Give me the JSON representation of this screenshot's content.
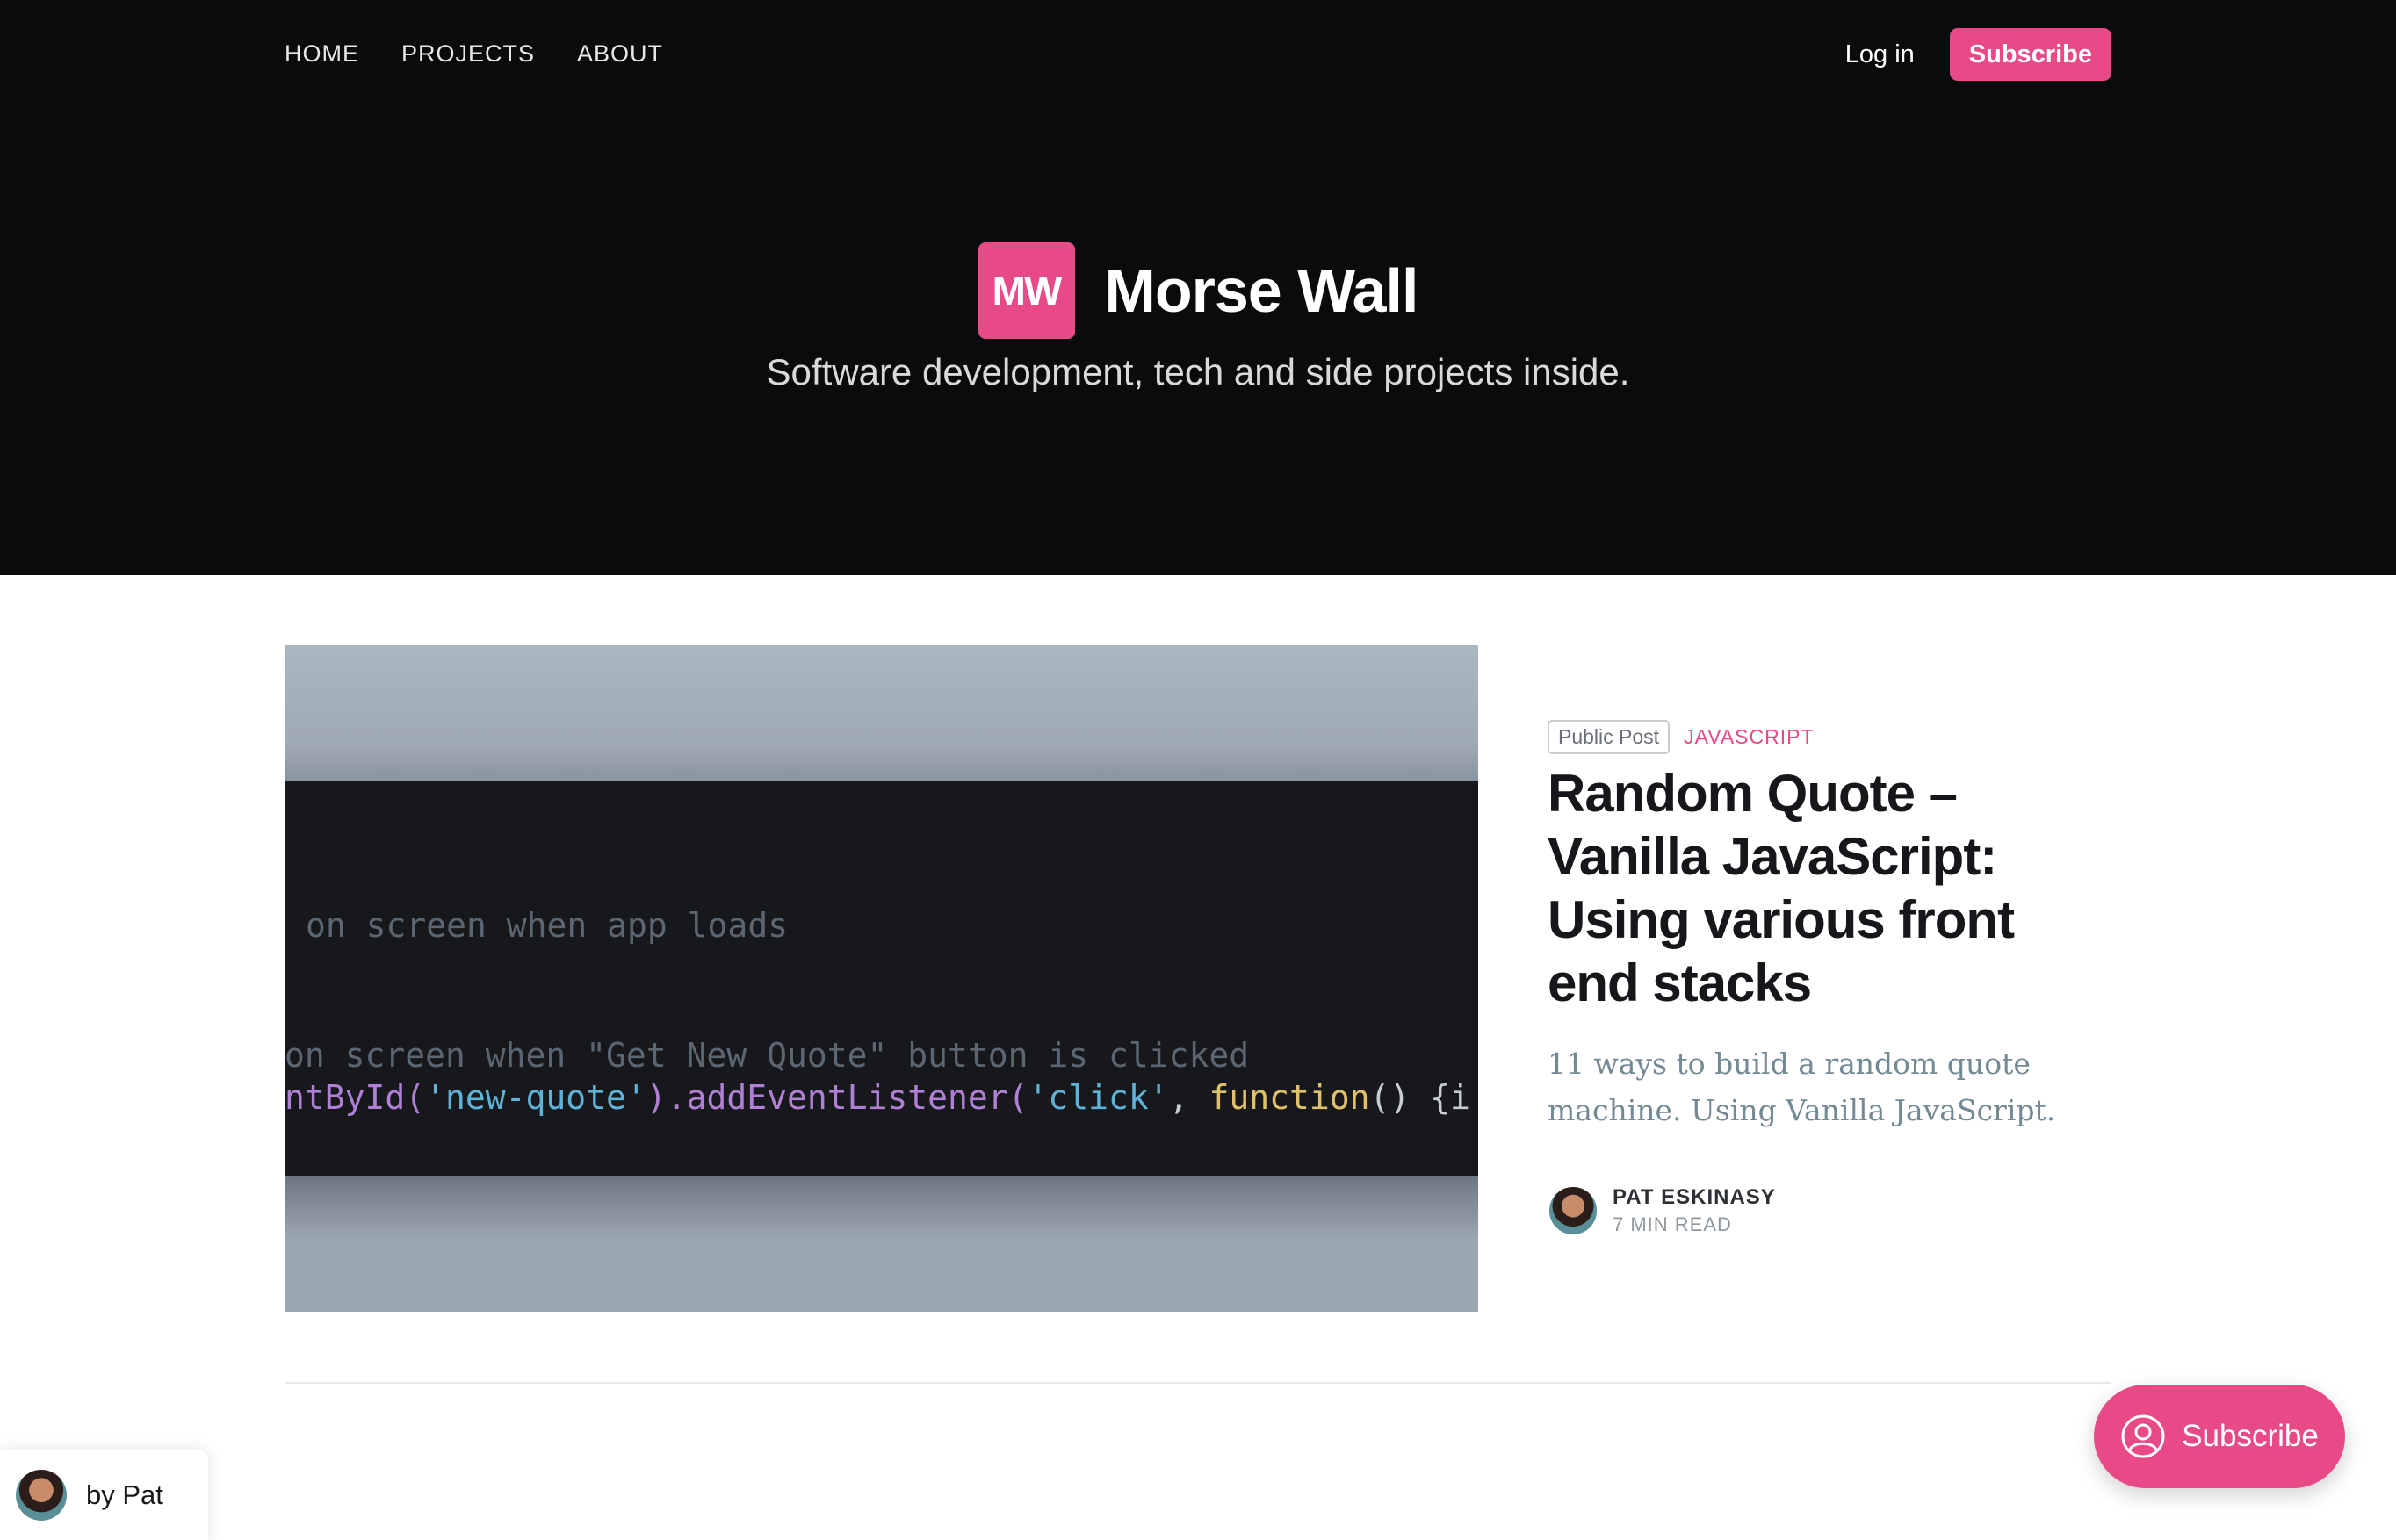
{
  "nav": {
    "links": [
      "HOME",
      "PROJECTS",
      "ABOUT"
    ],
    "login_label": "Log in",
    "subscribe_label": "Subscribe"
  },
  "site": {
    "logo_text": "MW",
    "name": "Morse Wall",
    "tagline": "Software development, tech and side projects inside."
  },
  "featured": {
    "code_lines": {
      "line1": "on screen when app loads",
      "line2": "on screen when \"Get New Quote\" button is clicked",
      "line3_fn": "ntById(",
      "line3_str1": "'new-quote'",
      "line3_mid": ").addEventListener(",
      "line3_str2": "'click'",
      "line3_sep": ", ",
      "line3_kw": "function",
      "line3_end": "() {i"
    },
    "visibility_badge": "Public Post",
    "tag": "JAVASCRIPT",
    "title": "Random Quote – Vanilla JavaScript: Using various front end stacks",
    "excerpt": "11 ways to build a random quote machine. Using Vanilla JavaScript.",
    "author": "PAT ESKINASY",
    "read_time": "7 MIN READ"
  },
  "portal": {
    "label": "Subscribe"
  },
  "by_badge": {
    "label": "by Pat"
  },
  "colors": {
    "accent": "#e84a88",
    "hero_bg": "#0a0b0d"
  }
}
